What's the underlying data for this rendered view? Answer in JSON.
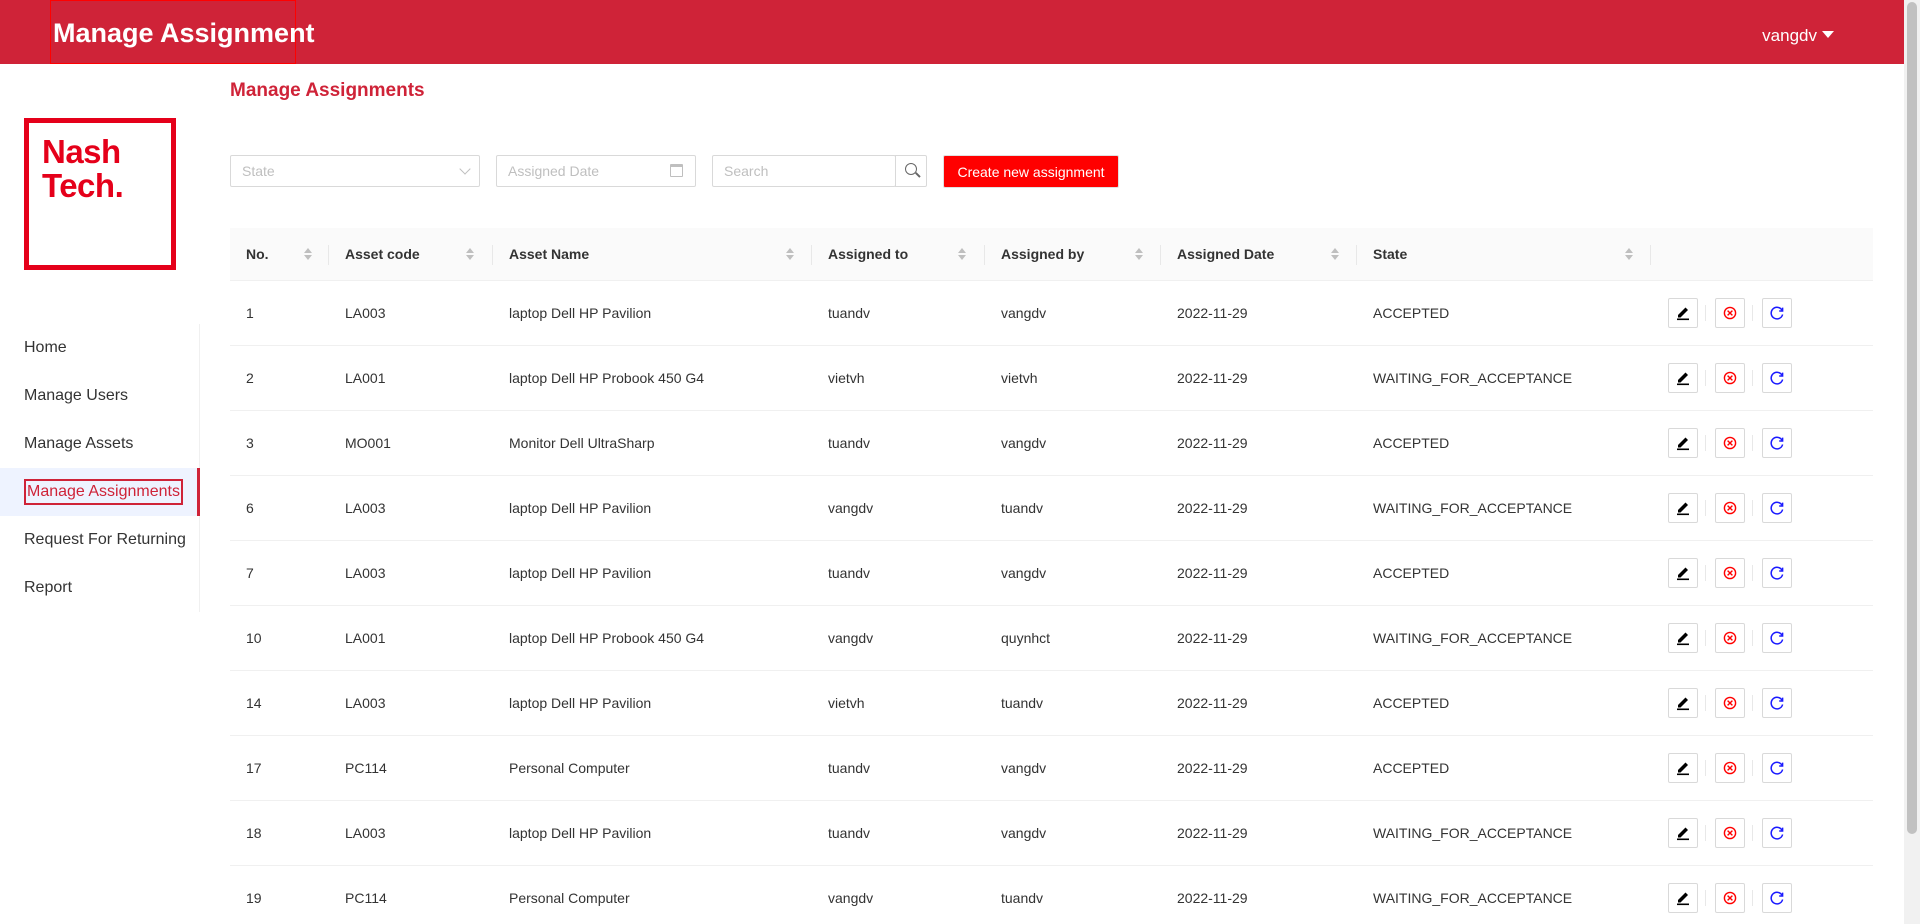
{
  "header": {
    "app_title": "Manage Assignment",
    "username": "vangdv"
  },
  "logo": {
    "line1": "Nash",
    "line2": "Tech."
  },
  "sidebar": {
    "items": [
      {
        "label": "Home",
        "active": false
      },
      {
        "label": "Manage Users",
        "active": false
      },
      {
        "label": "Manage Assets",
        "active": false
      },
      {
        "label": "Manage Assignments",
        "active": true
      },
      {
        "label": "Request For Returning",
        "active": false
      },
      {
        "label": "Report",
        "active": false
      }
    ]
  },
  "main": {
    "page_title": "Manage Assignments",
    "filters": {
      "state_placeholder": "State",
      "date_placeholder": "Assigned Date",
      "search_placeholder": "Search",
      "create_label": "Create new assignment"
    },
    "table": {
      "columns": [
        "No.",
        "Asset code",
        "Asset Name",
        "Assigned to",
        "Assigned by",
        "Assigned Date",
        "State"
      ],
      "rows": [
        {
          "no": "1",
          "asset_code": "LA003",
          "asset_name": "laptop Dell HP Pavilion",
          "assigned_to": "tuandv",
          "assigned_by": "vangdv",
          "assigned_date": "2022-11-29",
          "state": "ACCEPTED"
        },
        {
          "no": "2",
          "asset_code": "LA001",
          "asset_name": "laptop Dell HP Probook 450 G4",
          "assigned_to": "vietvh",
          "assigned_by": "vietvh",
          "assigned_date": "2022-11-29",
          "state": "WAITING_FOR_ACCEPTANCE"
        },
        {
          "no": "3",
          "asset_code": "MO001",
          "asset_name": "Monitor Dell UltraSharp",
          "assigned_to": "tuandv",
          "assigned_by": "vangdv",
          "assigned_date": "2022-11-29",
          "state": "ACCEPTED"
        },
        {
          "no": "6",
          "asset_code": "LA003",
          "asset_name": "laptop Dell HP Pavilion",
          "assigned_to": "vangdv",
          "assigned_by": "tuandv",
          "assigned_date": "2022-11-29",
          "state": "WAITING_FOR_ACCEPTANCE"
        },
        {
          "no": "7",
          "asset_code": "LA003",
          "asset_name": "laptop Dell HP Pavilion",
          "assigned_to": "tuandv",
          "assigned_by": "vangdv",
          "assigned_date": "2022-11-29",
          "state": "ACCEPTED"
        },
        {
          "no": "10",
          "asset_code": "LA001",
          "asset_name": "laptop Dell HP Probook 450 G4",
          "assigned_to": "vangdv",
          "assigned_by": "quynhct",
          "assigned_date": "2022-11-29",
          "state": "WAITING_FOR_ACCEPTANCE"
        },
        {
          "no": "14",
          "asset_code": "LA003",
          "asset_name": "laptop Dell HP Pavilion",
          "assigned_to": "vietvh",
          "assigned_by": "tuandv",
          "assigned_date": "2022-11-29",
          "state": "ACCEPTED"
        },
        {
          "no": "17",
          "asset_code": "PC114",
          "asset_name": "Personal Computer",
          "assigned_to": "tuandv",
          "assigned_by": "vangdv",
          "assigned_date": "2022-11-29",
          "state": "ACCEPTED"
        },
        {
          "no": "18",
          "asset_code": "LA003",
          "asset_name": "laptop Dell HP Pavilion",
          "assigned_to": "tuandv",
          "assigned_by": "vangdv",
          "assigned_date": "2022-11-29",
          "state": "WAITING_FOR_ACCEPTANCE"
        },
        {
          "no": "19",
          "asset_code": "PC114",
          "asset_name": "Personal Computer",
          "assigned_to": "vangdv",
          "assigned_by": "tuandv",
          "assigned_date": "2022-11-29",
          "state": "WAITING_FOR_ACCEPTANCE"
        }
      ],
      "row_actions": [
        {
          "name": "edit",
          "icon": "pencil-icon"
        },
        {
          "name": "delete",
          "icon": "close-circle-icon"
        },
        {
          "name": "return",
          "icon": "refresh-icon"
        }
      ]
    }
  },
  "colors": {
    "brand": "#cf2338",
    "primary_button": "#ff0000",
    "logo": "#e5001a",
    "edit_icon": "#000000",
    "delete_icon": "#ff0000",
    "return_icon": "#1a1aff"
  }
}
